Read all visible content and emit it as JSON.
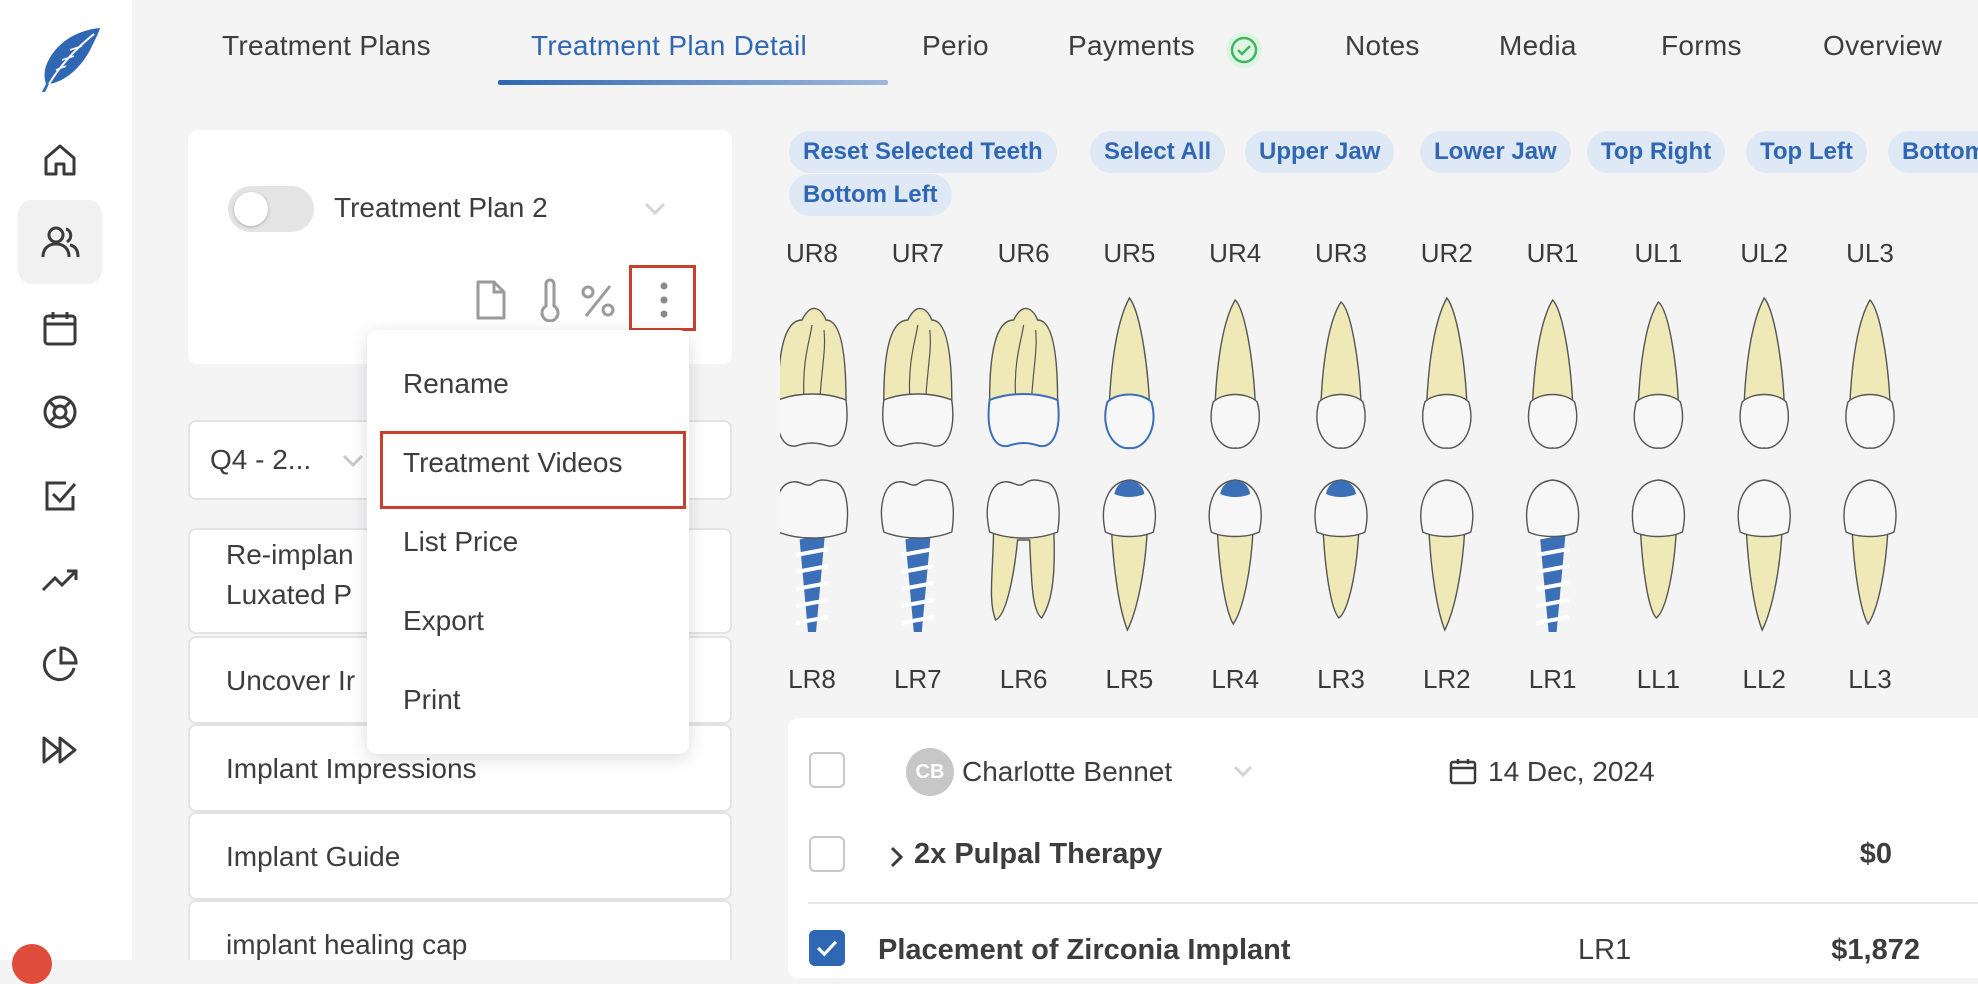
{
  "tabs": [
    {
      "label": "Treatment Plans"
    },
    {
      "label": "Treatment Plan Detail"
    },
    {
      "label": "Perio"
    },
    {
      "label": "Payments"
    },
    {
      "label": "Notes"
    },
    {
      "label": "Media"
    },
    {
      "label": "Forms"
    },
    {
      "label": "Overview"
    }
  ],
  "active_tab": "Treatment Plan Detail",
  "plan": {
    "name": "Treatment Plan 2",
    "active": false
  },
  "quarter_select": {
    "value": "Q4 - 2..."
  },
  "procedures_list": [
    {
      "line1": "Re-implan",
      "line2": "Luxated P"
    },
    {
      "label": "Uncover Ir"
    },
    {
      "label": "Implant Impressions"
    },
    {
      "label": "Implant Guide"
    },
    {
      "label": "implant healing cap"
    }
  ],
  "menu": {
    "items": [
      "Rename",
      "Treatment Videos",
      "List Price",
      "Export",
      "Print"
    ],
    "highlighted": "Treatment Videos"
  },
  "chips": [
    "Reset Selected Teeth",
    "Select All",
    "Upper Jaw",
    "Lower Jaw",
    "Top Right",
    "Top Left",
    "Bottom",
    "Bottom Left"
  ],
  "teeth": {
    "upper": [
      "UR8",
      "UR7",
      "UR6",
      "UR5",
      "UR4",
      "UR3",
      "UR2",
      "UR1",
      "UL1",
      "UL2",
      "UL3"
    ],
    "lower": [
      "LR8",
      "LR7",
      "LR6",
      "LR5",
      "LR4",
      "LR3",
      "LR2",
      "LR1",
      "LL1",
      "LL2",
      "LL3"
    ]
  },
  "table": {
    "provider_initials": "CB",
    "provider": "Charlotte Bennet",
    "date": "14 Dec, 2024",
    "rows": [
      {
        "name": "2x Pulpal Therapy",
        "tooth": "",
        "price": "$0",
        "checked": false
      },
      {
        "name": "Placement of Zirconia Implant",
        "tooth": "LR1",
        "price": "$1,872",
        "checked": true
      }
    ]
  },
  "colors": {
    "accent": "#2f67b4",
    "highlight_box": "#c8412f",
    "success": "#3fb55e",
    "tooth_root": "#efe9b8",
    "implant": "#3b6fb8"
  },
  "icons": [
    "feather-logo-icon",
    "home-icon",
    "users-icon",
    "calendar-icon",
    "lifebuoy-icon",
    "checkbox-icon",
    "trend-icon",
    "pie-chart-icon",
    "fast-forward-icon",
    "document-icon",
    "thermometer-icon",
    "percent-icon",
    "more-vertical-icon",
    "check-circle-icon",
    "chevron-down-icon",
    "chevron-right-icon"
  ]
}
